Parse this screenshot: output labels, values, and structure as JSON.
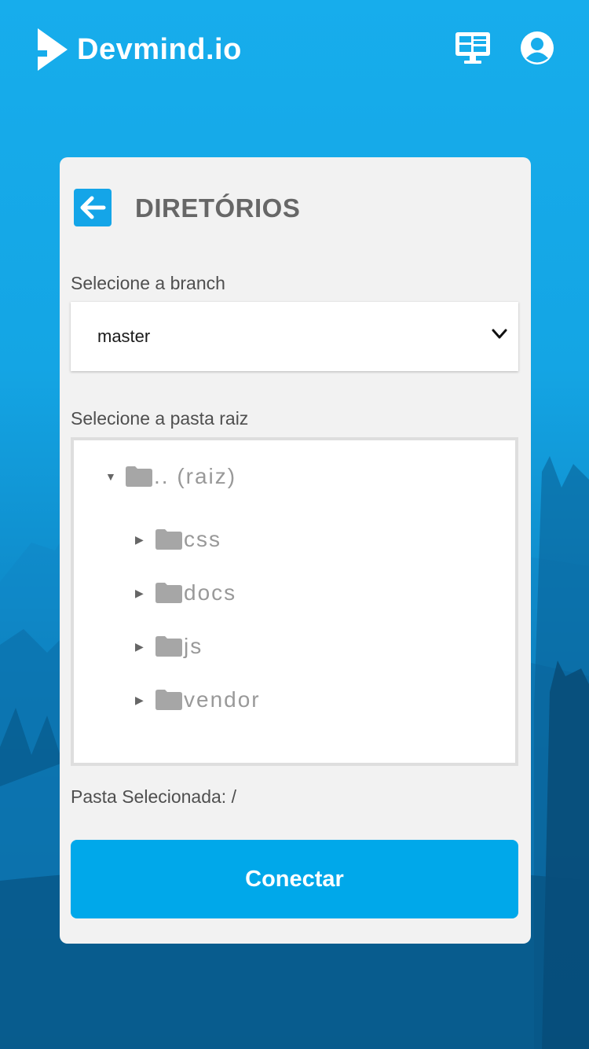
{
  "header": {
    "app_name": "Devmind.io",
    "logo_icon": "play-logo-icon",
    "dashboard_icon": "monitor-dashboard-icon",
    "account_icon": "user-account-icon"
  },
  "card": {
    "title": "DIRETÓRIOS",
    "back_icon": "arrow-left-icon",
    "branch_label": "Selecione a branch",
    "branch_value": "master",
    "folder_label": "Selecione a pasta raiz",
    "tree": {
      "root": ".. (raiz)",
      "children": [
        "css",
        "docs",
        "js",
        "vendor"
      ]
    },
    "selected_label": "Pasta Selecionada: /",
    "connect_label": "Conectar"
  },
  "colors": {
    "accent": "#00a8ea",
    "background_top": "#17adec",
    "background_bottom": "#085a8a",
    "card": "#f2f2f2"
  }
}
